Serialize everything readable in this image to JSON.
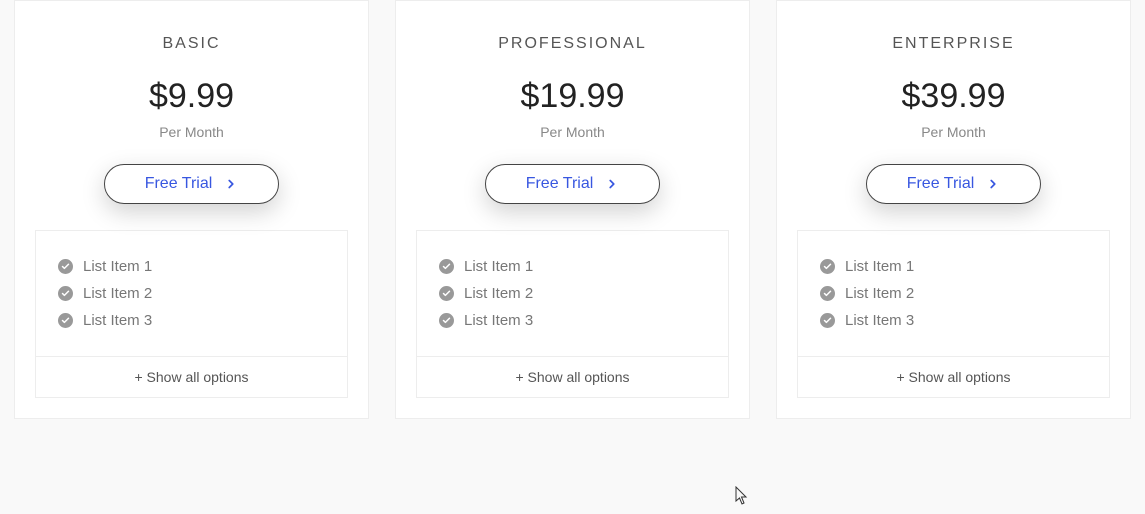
{
  "plans": [
    {
      "name": "BASIC",
      "price": "$9.99",
      "period": "Per Month",
      "cta": "Free Trial",
      "features": [
        "List Item 1",
        "List Item 2",
        "List Item 3"
      ],
      "show_all": "+ Show all options"
    },
    {
      "name": "PROFESSIONAL",
      "price": "$19.99",
      "period": "Per Month",
      "cta": "Free Trial",
      "features": [
        "List Item 1",
        "List Item 2",
        "List Item 3"
      ],
      "show_all": "+ Show all options"
    },
    {
      "name": "ENTERPRISE",
      "price": "$39.99",
      "period": "Per Month",
      "cta": "Free Trial",
      "features": [
        "List Item 1",
        "List Item 2",
        "List Item 3"
      ],
      "show_all": "+ Show all options"
    }
  ]
}
